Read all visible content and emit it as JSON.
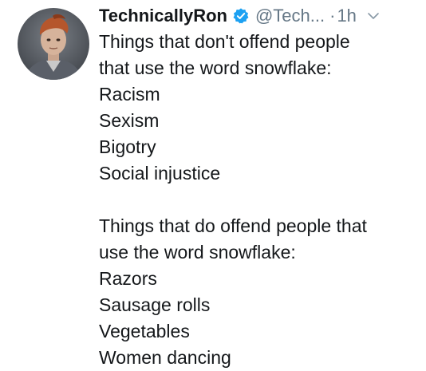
{
  "tweet": {
    "author": {
      "display_name": "TechnicallyRon",
      "handle": "@Tech...",
      "verified": true,
      "avatar_icon": "user-avatar"
    },
    "separator": "·",
    "timestamp": "1h",
    "menu_icon": "chevron-down-icon",
    "colors": {
      "verified_badge": "#1da1f2",
      "meta_text": "#657786",
      "body_text": "#14171a"
    },
    "lines": [
      "Things that don't offend people",
      "that use the word snowflake:",
      "Racism",
      "Sexism",
      "Bigotry",
      "Social injustice",
      "Things that do offend people that",
      "use the word snowflake:",
      "Razors",
      "Sausage rolls",
      "Vegetables",
      "Women dancing"
    ]
  }
}
